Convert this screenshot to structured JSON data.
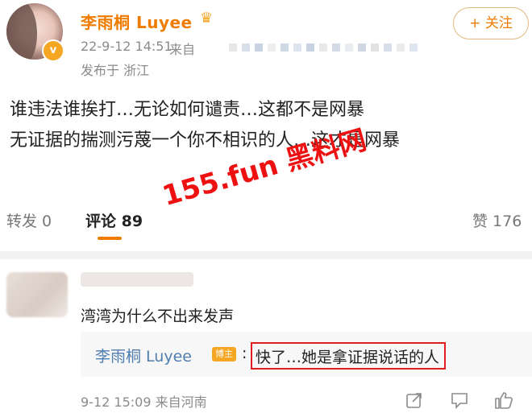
{
  "post": {
    "author": {
      "name": "李雨桐 Luyee",
      "verified_badge": "v",
      "crown_icon": "crown-icon"
    },
    "time": "22-9-12 14:51",
    "source_prefix": "来自",
    "location": "发布于 浙江",
    "follow_label": "+ 关注",
    "content": [
      "谁违法谁挨打…无论如何谴责…这都不是网暴",
      "无证据的揣测污蔑一个你不相识的人…这才是网暴"
    ]
  },
  "stats": {
    "repost": "转发 0",
    "comment": "评论 89",
    "like": "赞 176"
  },
  "watermark": "155.fun 黑料网",
  "comment": {
    "text": "湾湾为什么不出来发声",
    "reply": {
      "author": "李雨桐 Luyee",
      "badge": "博主",
      "colon": ":",
      "text": "快了…她是拿证据说话的人"
    },
    "time": "9-12 15:09 来自河南",
    "icons": [
      "share-icon",
      "comment-icon",
      "like-icon"
    ]
  },
  "colors": {
    "accent": "#ef7c00",
    "link": "#507daf",
    "watermark": "#ee1111",
    "highlight_border": "#e41b1b"
  }
}
